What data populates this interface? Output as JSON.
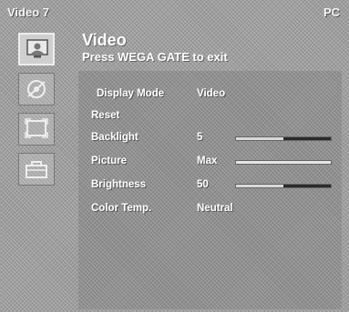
{
  "title_bar": {
    "input_label": "Video 7",
    "right_label": "PC"
  },
  "header": {
    "title": "Video",
    "subtitle": "Press WEGA GATE to exit"
  },
  "sidebar": {
    "tabs": [
      {
        "icon": "video-monitor-icon",
        "active": true
      },
      {
        "icon": "audio-disc-icon",
        "active": false
      },
      {
        "icon": "screen-frame-icon",
        "active": false
      },
      {
        "icon": "setup-toolbox-icon",
        "active": false
      }
    ]
  },
  "menu": {
    "items": [
      {
        "label": "Display Mode",
        "value": "Video"
      },
      {
        "label": "Reset",
        "value": ""
      },
      {
        "label": "Backlight",
        "value": "5",
        "level_percent": 50
      },
      {
        "label": "Picture",
        "value": "Max",
        "level_percent": 100
      },
      {
        "label": "Brightness",
        "value": "50",
        "level_percent": 50
      },
      {
        "label": "Color Temp.",
        "value": "Neutral"
      }
    ]
  }
}
